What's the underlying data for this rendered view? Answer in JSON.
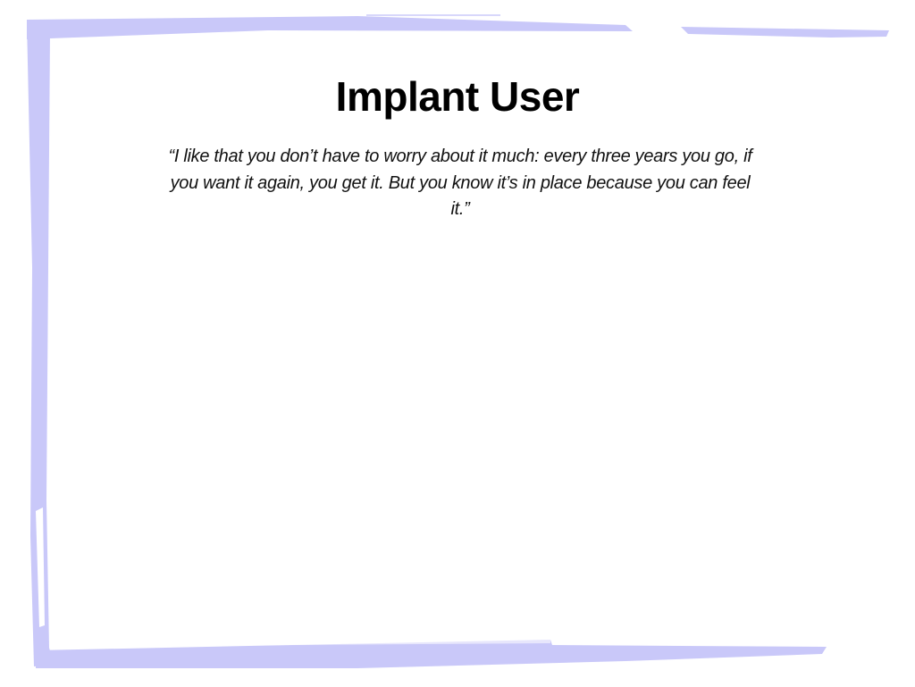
{
  "slide": {
    "title": "Implant User",
    "quote": "“I like that you don’t have to worry about it much: every three years you go, if you want it again, you get it. But you know it’s in place because you can feel it.”"
  },
  "colors": {
    "frame": "#c9c8f9",
    "background": "#ffffff",
    "text": "#000000"
  }
}
